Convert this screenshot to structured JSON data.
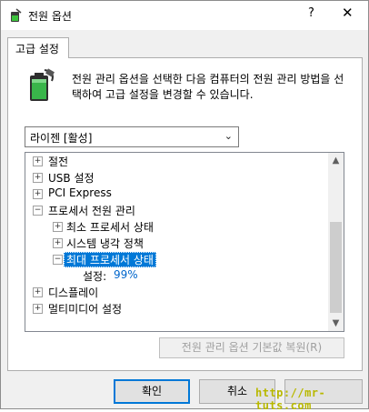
{
  "window": {
    "title": "전원 옵션",
    "help": "?",
    "close": "✕"
  },
  "tab": {
    "label": "고급 설정"
  },
  "description": "전원 관리 옵션을 선택한 다음 컴퓨터의 전원 관리 방법을 선택하여 고급 설정을 변경할 수 있습니다.",
  "plan": {
    "selected": "라이젠 [활성]"
  },
  "tree": {
    "items": [
      {
        "label": "절전",
        "expander": "+"
      },
      {
        "label": "USB 설정",
        "expander": "+"
      },
      {
        "label": "PCI Express",
        "expander": "+"
      },
      {
        "label": "프로세서 전원 관리",
        "expander": "−"
      },
      {
        "label": "최소 프로세서 상태",
        "expander": "+"
      },
      {
        "label": "시스템 냉각 정책",
        "expander": "+"
      },
      {
        "label": "최대 프로세서 상태",
        "expander": "−"
      },
      {
        "label": "설정:",
        "value": "99%"
      },
      {
        "label": "디스플레이",
        "expander": "+"
      },
      {
        "label": "멀티미디어 설정",
        "expander": "+"
      }
    ]
  },
  "buttons": {
    "restore": "전원 관리 옵션 기본값 복원(R)",
    "ok": "확인",
    "cancel": "취소",
    "apply": ""
  },
  "watermark": "http://mr-tuts.com",
  "colors": {
    "selection": "#0078d7",
    "setting_value": "#0066cc",
    "icon": "battery-plug-icon"
  }
}
